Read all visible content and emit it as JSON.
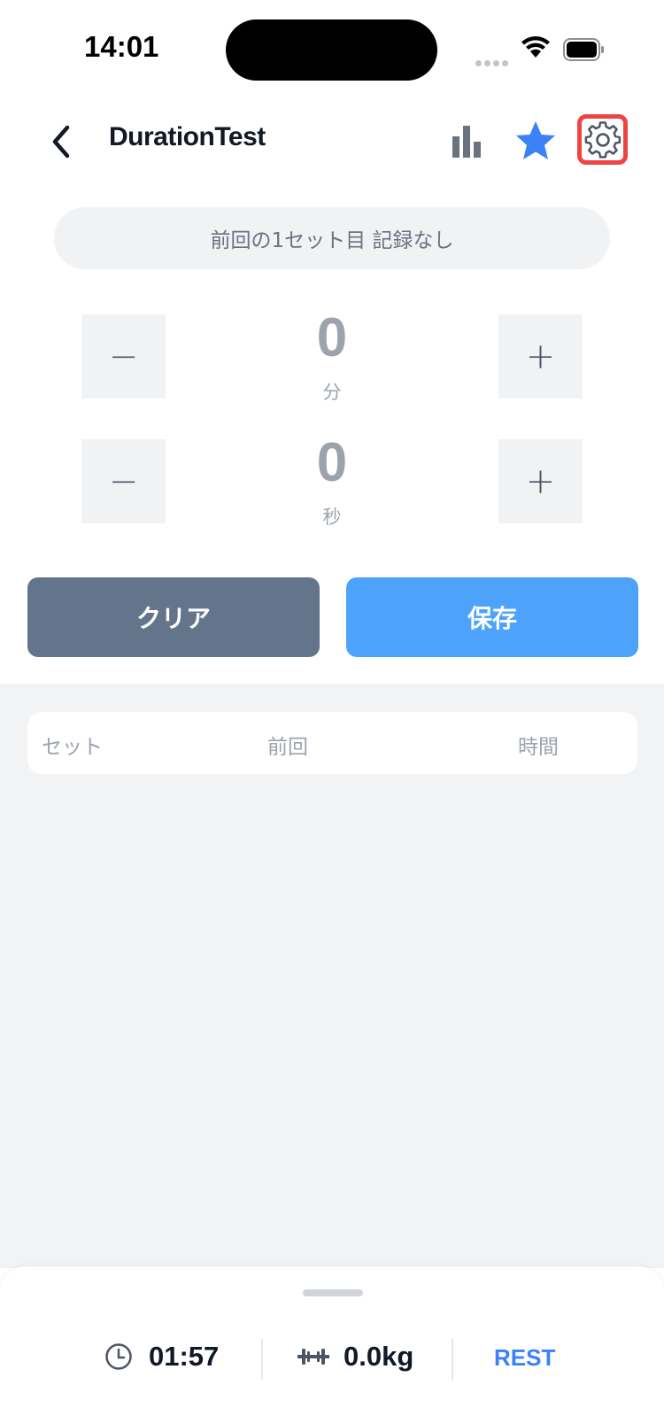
{
  "status_bar": {
    "time": "14:01"
  },
  "nav": {
    "title": "DurationTest",
    "icons": [
      "chevron-left-icon",
      "bar-chart-icon",
      "star-icon",
      "gear-icon"
    ]
  },
  "previous_record": {
    "text": "前回の1セット目 記録なし"
  },
  "stepper_minutes": {
    "value": "0",
    "unit": "分",
    "minus_label": "−",
    "plus_label": "+"
  },
  "stepper_seconds": {
    "value": "0",
    "unit": "秒",
    "minus_label": "−",
    "plus_label": "+"
  },
  "actions": {
    "clear_label": "クリア",
    "save_label": "保存"
  },
  "table": {
    "columns": [
      "セット",
      "前回",
      "時間"
    ],
    "rows": []
  },
  "bottom_bar": {
    "timer": "01:57",
    "weight": "0.0kg",
    "rest_label": "REST"
  },
  "colors": {
    "accent": "#3b82f6",
    "save_button": "#4da3fb",
    "clear_button": "#64748b",
    "highlight_border": "#ef4444",
    "background_gray": "#f2f3f5"
  }
}
